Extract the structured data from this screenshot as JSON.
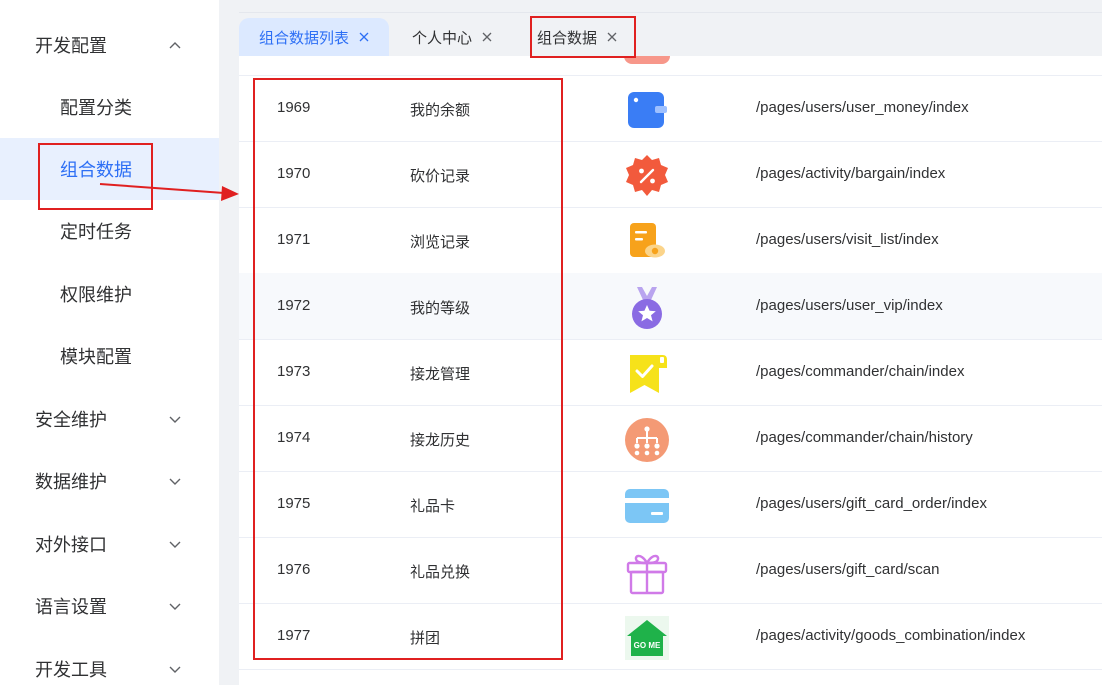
{
  "sidebar": {
    "items": [
      {
        "label": "开发配置",
        "kind": "top",
        "expanded": true
      },
      {
        "label": "配置分类",
        "kind": "sub"
      },
      {
        "label": "组合数据",
        "kind": "sub",
        "active": true
      },
      {
        "label": "定时任务",
        "kind": "sub"
      },
      {
        "label": "权限维护",
        "kind": "sub"
      },
      {
        "label": "模块配置",
        "kind": "sub"
      },
      {
        "label": "安全维护",
        "kind": "top",
        "expanded": false
      },
      {
        "label": "数据维护",
        "kind": "top",
        "expanded": false
      },
      {
        "label": "对外接口",
        "kind": "top",
        "expanded": false
      },
      {
        "label": "语言设置",
        "kind": "top",
        "expanded": false
      },
      {
        "label": "开发工具",
        "kind": "top",
        "expanded": false
      }
    ]
  },
  "tabs": [
    {
      "label": "组合数据列表",
      "active": true
    },
    {
      "label": "个人中心",
      "active": false
    },
    {
      "label": "组合数据",
      "active": false
    }
  ],
  "table": {
    "rows": [
      {
        "id": "1969",
        "name": "我的余额",
        "icon": "wallet-icon",
        "path": "/pages/users/user_money/index"
      },
      {
        "id": "1970",
        "name": "砍价记录",
        "icon": "discount-badge-icon",
        "path": "/pages/activity/bargain/index"
      },
      {
        "id": "1971",
        "name": "浏览记录",
        "icon": "browse-history-icon",
        "path": "/pages/users/visit_list/index"
      },
      {
        "id": "1972",
        "name": "我的等级",
        "icon": "medal-star-icon",
        "path": "/pages/users/user_vip/index"
      },
      {
        "id": "1973",
        "name": "接龙管理",
        "icon": "chain-check-icon",
        "path": "/pages/commander/chain/index"
      },
      {
        "id": "1974",
        "name": "接龙历史",
        "icon": "org-tree-icon",
        "path": "/pages/commander/chain/history"
      },
      {
        "id": "1975",
        "name": "礼品卡",
        "icon": "credit-card-icon",
        "path": "/pages/users/gift_card_order/index"
      },
      {
        "id": "1976",
        "name": "礼品兑换",
        "icon": "gift-box-icon",
        "path": "/pages/users/gift_card/scan"
      },
      {
        "id": "1977",
        "name": "拼团",
        "icon": "group-home-icon",
        "icon_text": "GO ME",
        "path": "/pages/activity/goods_combination/index"
      }
    ],
    "highlighted_row": "1972"
  },
  "colors": {
    "accent": "#2d6ff5",
    "active_bg": "#e8f0fe",
    "annotation_red": "#e02020"
  }
}
